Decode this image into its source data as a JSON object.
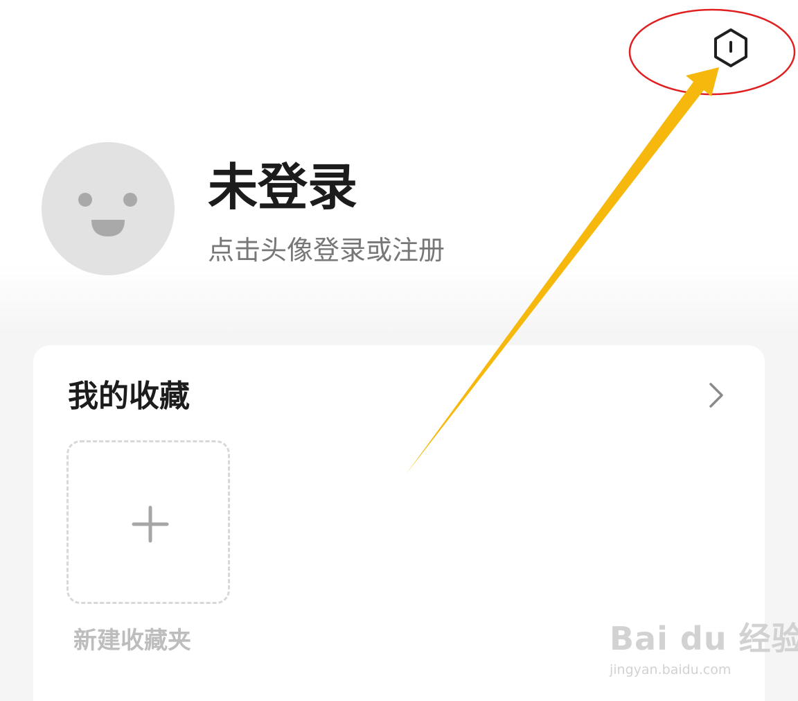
{
  "header": {
    "settings_icon": "hexagon-settings-icon"
  },
  "profile": {
    "avatar_icon": "smiley-face-icon",
    "name": "未登录",
    "hint": "点击头像登录或注册"
  },
  "favorites": {
    "title": "我的收藏",
    "more_icon": "chevron-right-icon",
    "new_folder_icon": "plus-icon",
    "new_folder_label": "新建收藏夹"
  },
  "watermark": {
    "main": "Bai du 经验",
    "sub": "jingyan.baidu.com"
  },
  "colors": {
    "annotation_circle": "#e02020",
    "annotation_arrow": "#f6b80c",
    "avatar_bg": "#e2e2e2"
  }
}
